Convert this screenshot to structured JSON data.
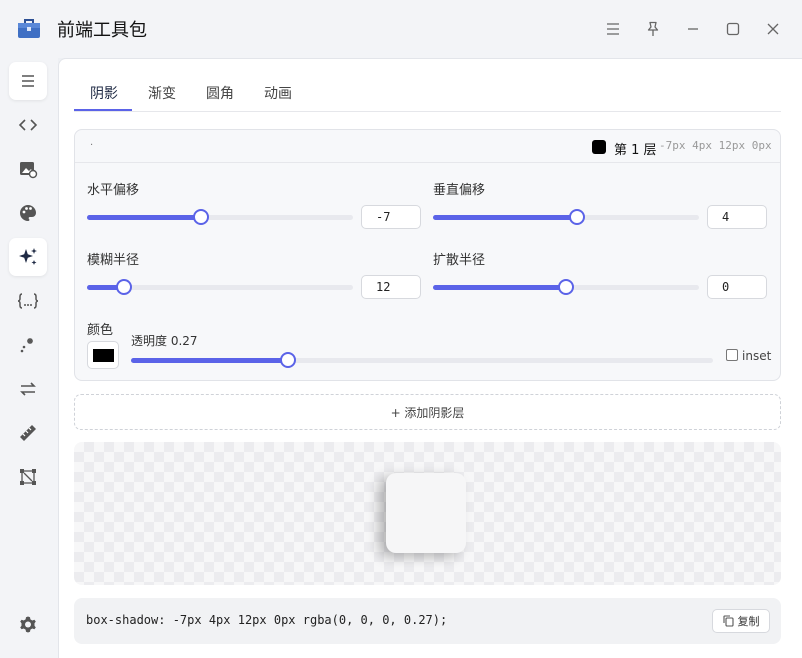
{
  "app": {
    "title": "前端工具包"
  },
  "tabs": [
    {
      "label": "阴影",
      "active": true
    },
    {
      "label": "渐变",
      "active": false
    },
    {
      "label": "圆角",
      "active": false
    },
    {
      "label": "动画",
      "active": false
    }
  ],
  "sidebar": {
    "items": [
      {
        "icon": "menu-icon"
      },
      {
        "icon": "code-icon"
      },
      {
        "icon": "image-icon"
      },
      {
        "icon": "palette-icon"
      },
      {
        "icon": "sparkles-icon",
        "active": true
      },
      {
        "icon": "braces-icon"
      },
      {
        "icon": "wand-icon"
      },
      {
        "icon": "arrows-swap-icon"
      },
      {
        "icon": "ruler-icon"
      },
      {
        "icon": "vector-icon"
      }
    ],
    "settings_icon": "gear-icon"
  },
  "layer": {
    "dot": "·",
    "label": "第 1 层",
    "values": "-7px 4px 12px 0px",
    "color": "#000000"
  },
  "controls": {
    "h_offset": {
      "label": "水平偏移",
      "value": "-7",
      "fraction": 0.43
    },
    "v_offset": {
      "label": "垂直偏移",
      "value": "4",
      "fraction": 0.54
    },
    "blur": {
      "label": "模糊半径",
      "value": "12",
      "fraction": 0.14
    },
    "spread": {
      "label": "扩散半径",
      "value": "0",
      "fraction": 0.5
    },
    "color": {
      "label": "颜色",
      "value": "#000000"
    },
    "opacity": {
      "label": "透明度 0.27",
      "fraction": 0.27
    },
    "inset": {
      "label": "inset",
      "checked": false
    }
  },
  "add_layer": {
    "label": "+ 添加阴影层"
  },
  "code": {
    "text": "box-shadow: -7px 4px 12px 0px rgba(0, 0, 0, 0.27);",
    "copy_label": "复制"
  },
  "colors": {
    "accent": "#5b63e8"
  }
}
